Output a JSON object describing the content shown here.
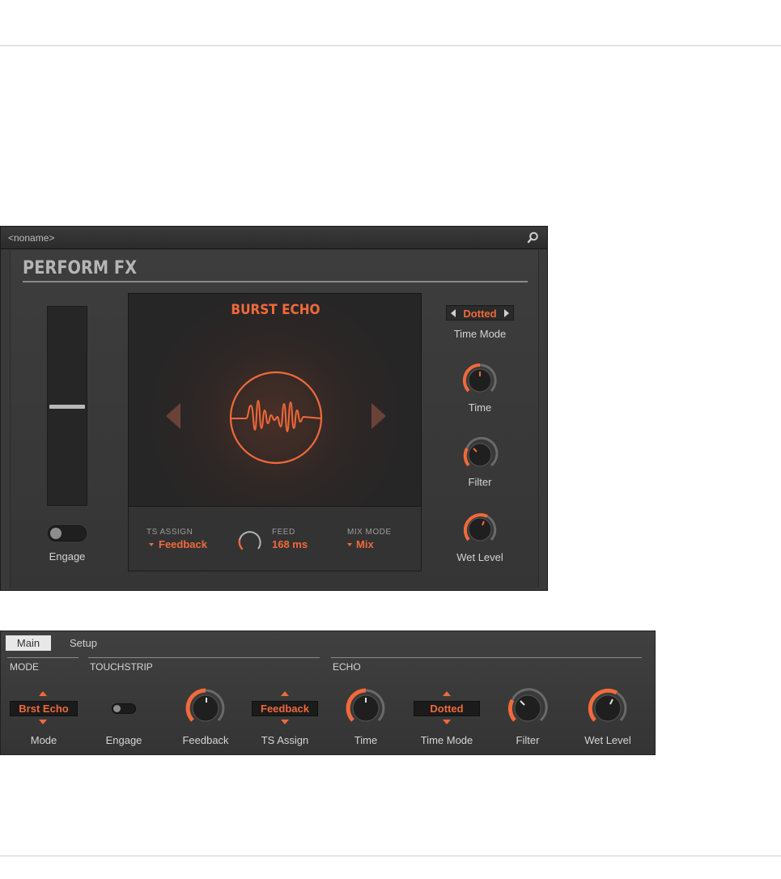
{
  "plugin": {
    "preset_name": "<noname>",
    "title": "PERFORM FX",
    "engage_label": "Engage",
    "fx_name": "BURST ECHO",
    "ts_assign_label": "TS ASSIGN",
    "ts_assign_value": "Feedback",
    "feed_label": "FEED",
    "feed_value": "168 ms",
    "mix_mode_label": "MIX MODE",
    "mix_mode_value": "Mix",
    "time_mode_value": "Dotted",
    "time_mode_label": "Time Mode",
    "knobs": [
      {
        "label": "Time"
      },
      {
        "label": "Filter"
      },
      {
        "label": "Wet Level"
      }
    ]
  },
  "strip": {
    "tabs": [
      "Main",
      "Setup"
    ],
    "sections": [
      "MODE",
      "TOUCHSTRIP",
      "ECHO"
    ],
    "mode_value": "Brst Echo",
    "ts_assign_value": "Feedback",
    "time_mode_value": "Dotted",
    "labels": [
      "Mode",
      "Engage",
      "Feedback",
      "TS Assign",
      "Time",
      "Time Mode",
      "Filter",
      "Wet Level"
    ]
  },
  "colors": {
    "accent": "#f06a3a",
    "panel": "#3a3a3a",
    "display": "#262626"
  },
  "icons": [
    "search-icon",
    "prev-arrow-icon",
    "next-arrow-icon",
    "waveform-emblem-icon",
    "dropdown-caret-icon"
  ]
}
